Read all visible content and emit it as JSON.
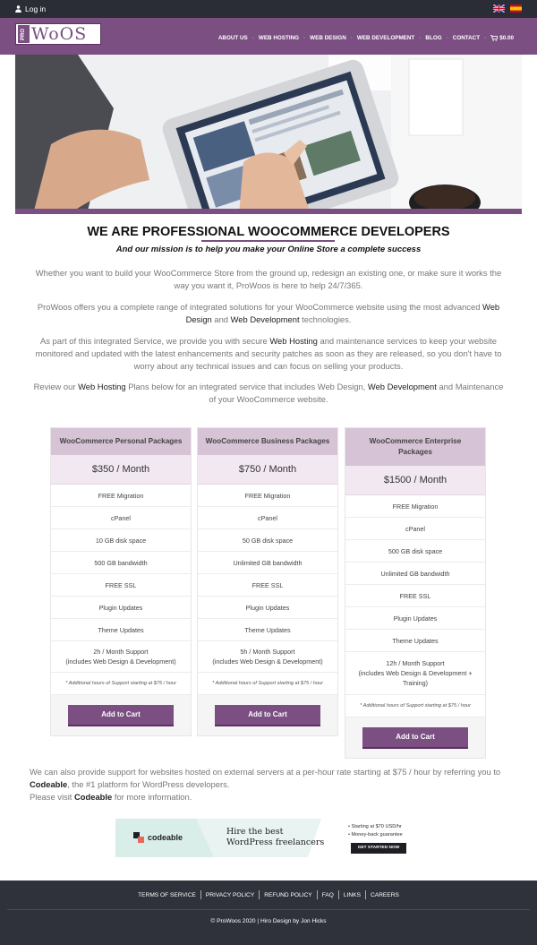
{
  "topbar": {
    "login_label": "Log in",
    "languages": [
      "uk-flag",
      "es-flag"
    ]
  },
  "brand": {
    "logo_pro": "PRO",
    "logo_text": "WoOS"
  },
  "nav": {
    "items": [
      "ABOUT US",
      "WEB HOSTING",
      "WEB DESIGN",
      "WEB DEVELOPMENT",
      "BLOG",
      "CONTACT"
    ],
    "cart_label": "$0.00"
  },
  "hero": {
    "image": "hands-using-tablet-photo"
  },
  "headline": "WE ARE PROFESSIONAL WOOCOMMERCE DEVELOPERS",
  "tagline": "And our mission is to help you make your Online Store a complete success",
  "paragraphs": {
    "p1": "Whether you want to build your WooCommerce Store from the ground up, redesign an existing one, or make sure it works the way you want it, ProWoos is here to help 24/7/365.",
    "p2_a": "ProWoos offers you a complete range of integrated solutions for your WooCommerce website using the most advanced ",
    "p2_link1": "Web Design",
    "p2_b": " and ",
    "p2_link2": "Web Development",
    "p2_c": " technologies.",
    "p3_a": "As part of this integrated Service, we provide you with secure ",
    "p3_link": "Web Hosting",
    "p3_b": " and maintenance services to keep your website monitored and updated with the latest enhancements and security patches as soon as they are released, so you don't have to worry about any technical issues and can focus on selling your products.",
    "p4_a": "Review our ",
    "p4_link1": "Web Hosting",
    "p4_b": " Plans below for an integrated service that includes Web Design, ",
    "p4_link2": "Web Development",
    "p4_c": " and Maintenance of your WooCommerce website."
  },
  "packages": [
    {
      "title": "WooCommerce Personal Packages",
      "price": "$350 / Month",
      "features": [
        "FREE Migration",
        "cPanel",
        "10 GB disk space",
        "500 GB bandwidth",
        "FREE SSL",
        "Plugin Updates",
        "Theme Updates"
      ],
      "support_line1": "2h / Month Support",
      "support_line2": "(includes Web Design & Development)",
      "support_line3": "",
      "note": "* Additional hours of Support starting at $75 / hour",
      "cta": "Add to Cart"
    },
    {
      "title": "WooCommerce Business Packages",
      "price": "$750 / Month",
      "features": [
        "FREE Migration",
        "cPanel",
        "50 GB disk space",
        "Unlimited GB bandwidth",
        "FREE SSL",
        "Plugin Updates",
        "Theme Updates"
      ],
      "support_line1": "5h / Month Support",
      "support_line2": "(includes Web Design & Development)",
      "support_line3": "",
      "note": "* Additional hours of Support starting at $75 / hour",
      "cta": "Add to Cart"
    },
    {
      "title": "WooCommerce Enterprise Packages",
      "price": "$1500 / Month",
      "features": [
        "FREE Migration",
        "cPanel",
        "500 GB disk space",
        "Unlimited GB bandwidth",
        "FREE SSL",
        "Plugin Updates",
        "Theme Updates"
      ],
      "support_line1": "12h / Month Support",
      "support_line2": "(includes Web Design & Development +",
      "support_line3": "Training)",
      "note": "* Additional hours of Support starting at $75 / hour",
      "cta": "Add to Cart"
    }
  ],
  "external": {
    "a": "We can also provide support for websites hosted on external servers at a per-hour rate starting at $75 / hour by referring you to ",
    "link1": "Codeable",
    "b": ", the #1 platform for WordPress developers.",
    "c": "Please visit ",
    "link2": "Codeable",
    "d": " for more information."
  },
  "banner": {
    "logo_text": "codeable",
    "headline_1": "Hire the best",
    "headline_2": "WordPress freelancers",
    "bullet_1": "Starting at $70 USD/hr",
    "bullet_2": "Money-back guarantee",
    "cta": "GET STARTED NOW"
  },
  "footer": {
    "links": [
      "TERMS OF SERVICE",
      "PRIVACY POLICY",
      "REFUND POLICY",
      "FAQ",
      "LINKS",
      "CAREERS"
    ],
    "copyright": "© ProWoos 2020 | Hiro Design by Jon Hicks"
  },
  "colors": {
    "brand_purple": "#7b4f82",
    "topbar": "#2a2d36",
    "footer": "#2f323b"
  }
}
